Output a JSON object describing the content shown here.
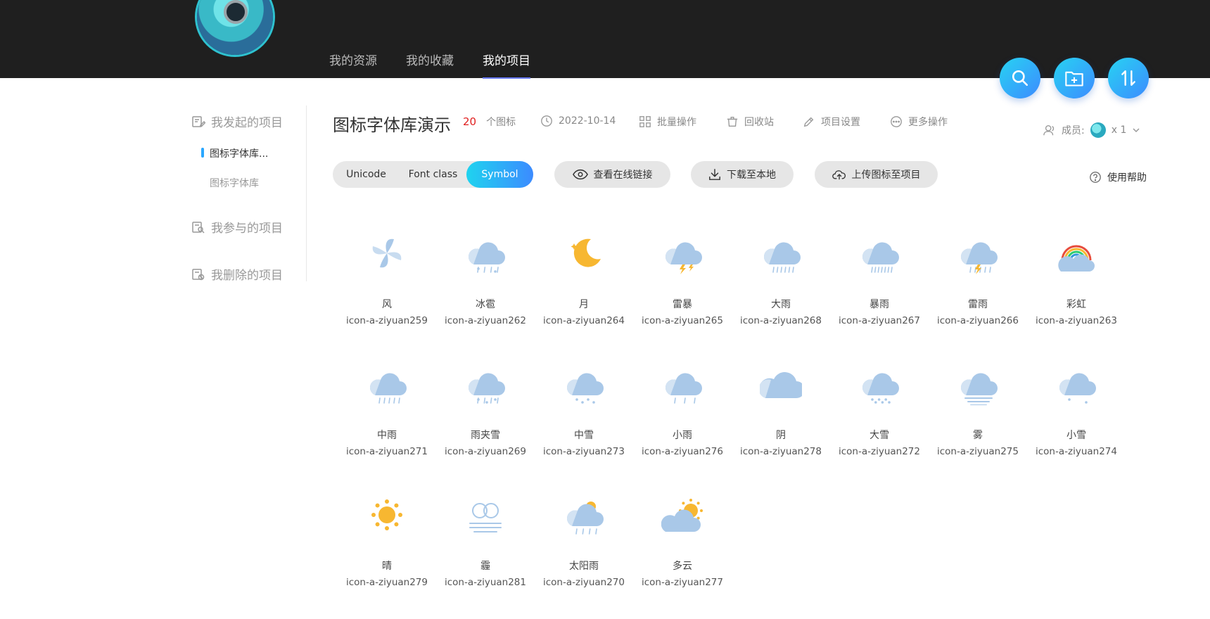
{
  "nav": {
    "resources": "我的资源",
    "favorites": "我的收藏",
    "projects": "我的项目"
  },
  "sidebar": {
    "initiated": "我发起的项目",
    "items": [
      {
        "label": "图标字体库..."
      },
      {
        "label": "图标字体库"
      }
    ],
    "joined": "我参与的项目",
    "deleted": "我删除的项目"
  },
  "project": {
    "title": "图标字体库演示",
    "count": "20",
    "count_label": "个图标",
    "date": "2022-10-14",
    "actions": {
      "batch": "批量操作",
      "recycle": "回收站",
      "settings": "项目设置",
      "more": "更多操作"
    },
    "members_label": "成员:",
    "members_count": "x 1"
  },
  "toolbar": {
    "tabs": [
      "Unicode",
      "Font class",
      "Symbol"
    ],
    "view_link": "查看在线链接",
    "download": "下载至本地",
    "upload": "上传图标至项目",
    "help": "使用帮助"
  },
  "icons": [
    {
      "name": "风",
      "code": "icon-a-ziyuan259",
      "icon": "wind-icon"
    },
    {
      "name": "冰雹",
      "code": "icon-a-ziyuan262",
      "icon": "hail-icon"
    },
    {
      "name": "月",
      "code": "icon-a-ziyuan264",
      "icon": "moon-icon"
    },
    {
      "name": "雷暴",
      "code": "icon-a-ziyuan265",
      "icon": "thunderstorm-icon"
    },
    {
      "name": "大雨",
      "code": "icon-a-ziyuan268",
      "icon": "heavy-rain-icon"
    },
    {
      "name": "暴雨",
      "code": "icon-a-ziyuan267",
      "icon": "rainstorm-icon"
    },
    {
      "name": "雷雨",
      "code": "icon-a-ziyuan266",
      "icon": "thunder-rain-icon"
    },
    {
      "name": "彩虹",
      "code": "icon-a-ziyuan263",
      "icon": "rainbow-icon"
    },
    {
      "name": "中雨",
      "code": "icon-a-ziyuan271",
      "icon": "moderate-rain-icon"
    },
    {
      "name": "雨夹雪",
      "code": "icon-a-ziyuan269",
      "icon": "sleet-icon"
    },
    {
      "name": "中雪",
      "code": "icon-a-ziyuan273",
      "icon": "moderate-snow-icon"
    },
    {
      "name": "小雨",
      "code": "icon-a-ziyuan276",
      "icon": "light-rain-icon"
    },
    {
      "name": "阴",
      "code": "icon-a-ziyuan278",
      "icon": "overcast-icon"
    },
    {
      "name": "大雪",
      "code": "icon-a-ziyuan272",
      "icon": "heavy-snow-icon"
    },
    {
      "name": "雾",
      "code": "icon-a-ziyuan275",
      "icon": "fog-icon"
    },
    {
      "name": "小雪",
      "code": "icon-a-ziyuan274",
      "icon": "light-snow-icon"
    },
    {
      "name": "晴",
      "code": "icon-a-ziyuan279",
      "icon": "sunny-icon"
    },
    {
      "name": "霾",
      "code": "icon-a-ziyuan281",
      "icon": "haze-icon"
    },
    {
      "name": "太阳雨",
      "code": "icon-a-ziyuan270",
      "icon": "sun-shower-icon"
    },
    {
      "name": "多云",
      "code": "icon-a-ziyuan277",
      "icon": "partly-cloudy-icon"
    }
  ]
}
